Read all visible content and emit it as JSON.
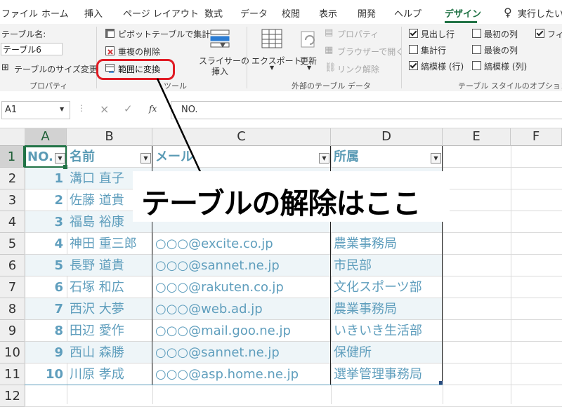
{
  "tabs": [
    "ファイル",
    "ホーム",
    "挿入",
    "ページ レイアウト",
    "数式",
    "データ",
    "校閲",
    "表示",
    "開発",
    "ヘルプ",
    "デザイン",
    "実行したい"
  ],
  "active_tab": "デザイン",
  "ribbon": {
    "properties": {
      "table_name_label": "テーブル名:",
      "table_name_value": "テーブル6",
      "resize_label": "テーブルのサイズ変更",
      "group_label": "プロパティ"
    },
    "tools": {
      "pivot_label": "ピボットテーブルで集計",
      "remove_dup_label": "重複の削除",
      "convert_label": "範囲に変換",
      "slicer_label_1": "スライサーの",
      "slicer_label_2": "挿入",
      "group_label": "ツール"
    },
    "external": {
      "export_label": "エクスポート",
      "refresh_label": "更新",
      "properties_label": "プロパティ",
      "browser_label": "ブラウザーで開く",
      "unlink_label": "リンク解除",
      "group_label": "外部のテーブル データ"
    },
    "style_options": {
      "header_row": "見出し行",
      "total_row": "集計行",
      "banded_rows": "縞模様 (行)",
      "first_column": "最初の列",
      "last_column": "最後の列",
      "banded_columns": "縞模様 (列)",
      "filter_button": "フィル",
      "group_label": "テーブル スタイルのオプション",
      "checked": {
        "header_row": true,
        "total_row": false,
        "banded_rows": true,
        "first_column": false,
        "last_column": false,
        "banded_columns": false,
        "filter_button": true
      }
    }
  },
  "formula_bar": {
    "name_box": "A1",
    "cancel": "×",
    "enter": "✓",
    "fx": "fx",
    "content": "NO."
  },
  "grid": {
    "columns": [
      "A",
      "B",
      "C",
      "D",
      "E",
      "F"
    ],
    "rows": [
      "1",
      "2",
      "3",
      "4",
      "5",
      "6",
      "7",
      "8",
      "9",
      "10",
      "11",
      "12"
    ],
    "headers": [
      "NO.",
      "名前",
      "メール",
      "所属"
    ],
    "data": [
      [
        "1",
        "溝口 直子",
        "",
        ""
      ],
      [
        "2",
        "佐藤 道貴",
        "",
        ""
      ],
      [
        "3",
        "福島 裕康",
        "",
        ""
      ],
      [
        "4",
        "神田 重三郎",
        "○○○@excite.co.jp",
        "農業事務局"
      ],
      [
        "5",
        "長野 道貴",
        "○○○@sannet.ne.jp",
        "市民部"
      ],
      [
        "6",
        "石塚 和広",
        "○○○@rakuten.co.jp",
        "文化スポーツ部"
      ],
      [
        "7",
        "西沢 大夢",
        "○○○@web.ad.jp",
        "農業事務局"
      ],
      [
        "8",
        "田辺 愛作",
        "○○○@mail.goo.ne.jp",
        "いきいき生活部"
      ],
      [
        "9",
        "西山 森勝",
        "○○○@sannet.ne.jp",
        "保健所"
      ],
      [
        "10",
        "川原 孝成",
        "○○○@asp.home.ne.jp",
        "選挙管理事務局"
      ]
    ]
  },
  "annotation": "テーブルの解除はここ",
  "colors": {
    "accent": "#217346",
    "table_text": "#5f9ebd",
    "highlight": "#e01b24",
    "band": "#eef5f8"
  }
}
